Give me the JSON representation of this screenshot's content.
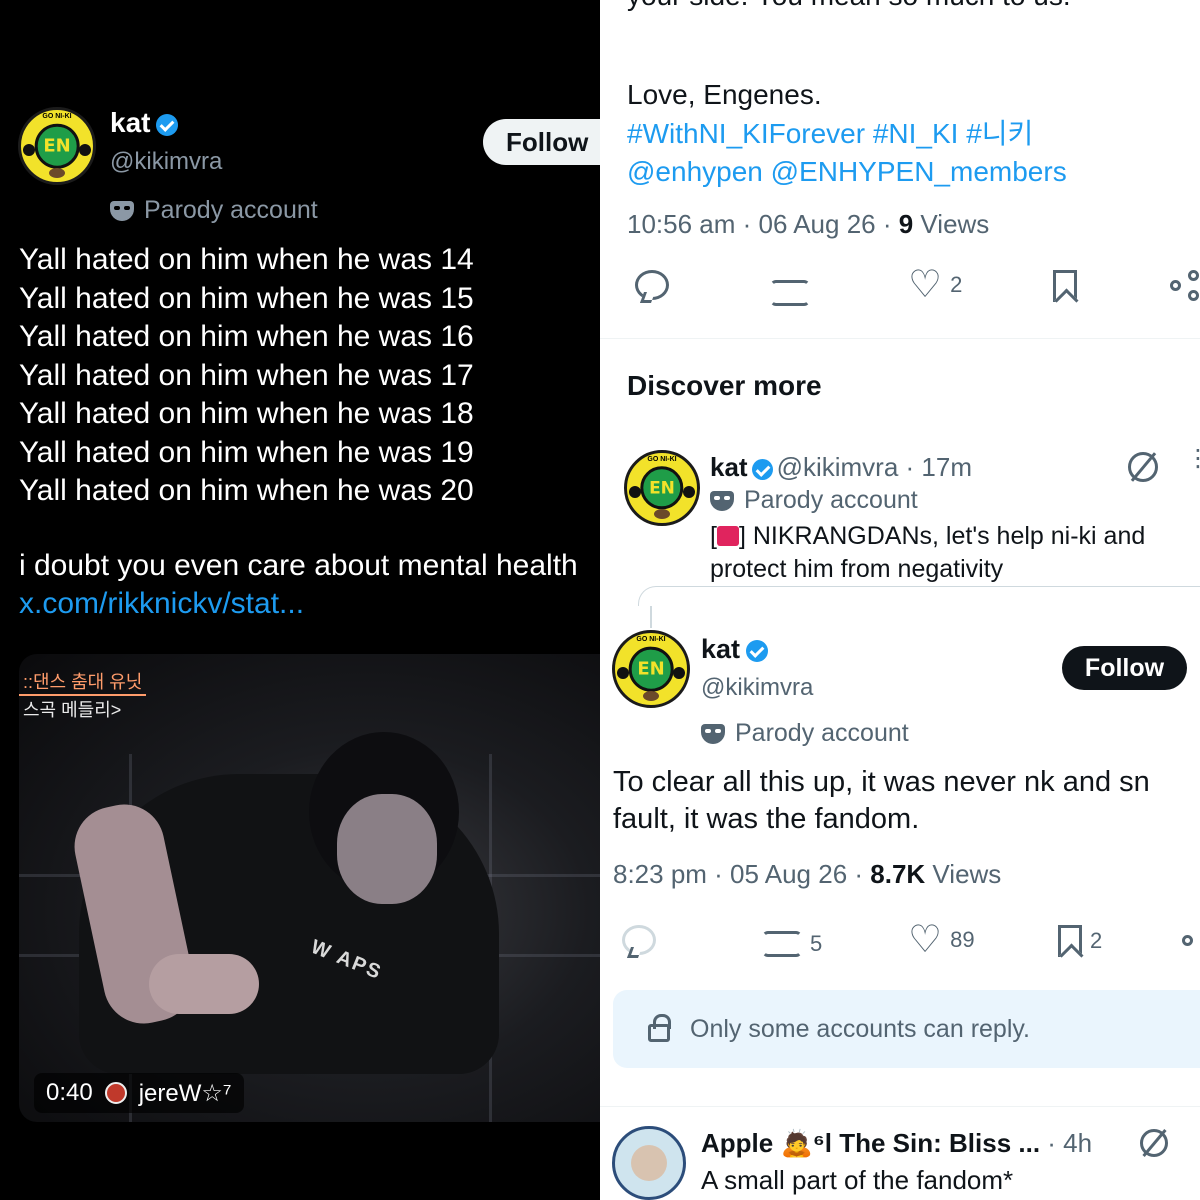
{
  "left_tweet": {
    "avatar_badge": "EN",
    "avatar_top_text": "GO NI-KI",
    "name": "kat",
    "handle": "@kikimvra",
    "follow_label": "Follow",
    "parody_label": "Parody account",
    "lines": [
      "Yall hated on him when he was 14",
      "Yall hated on him when he was 15",
      "Yall hated on him when he was 16",
      "Yall hated on him when he was 17",
      "Yall hated on him when he was 18",
      "Yall hated on him when he was 19",
      "Yall hated on him when he was 20"
    ],
    "tail_text": "i doubt you even care about mental health ",
    "link_text": "x.com/rikknickv/stat...",
    "video": {
      "korean_line1": "::댄스 춤대 유닛",
      "korean_line2": "스곡 메들리>",
      "shirt_text": "W APS",
      "duration": "0:40",
      "uploader": "jereW☆⁷"
    }
  },
  "right_panel": {
    "cut_text": "your side. You mean so much to us.",
    "love_line": "Love, Engenes.",
    "hashtags": "#WithNI_KIForever #NI_KI #니키",
    "mentions": "@enhypen @ENHYPEN_members",
    "meta1": {
      "time_date": "10:56 am · 06 Aug 26 · ",
      "views_count": "9",
      "views_label": " Views"
    },
    "actions1": {
      "likes": "2"
    },
    "discover_title": "Discover more",
    "discover_tweet": {
      "avatar_badge": "EN",
      "avatar_top_text": "GO NI-KI",
      "name": "kat",
      "handle_time": "@kikimvra · 17m",
      "parody_label": "Parody account",
      "text_after_alert": "] NIKRANGDANs, let's help ni-ki and protect him from negativity",
      "more": "⋮"
    },
    "main_tweet": {
      "avatar_badge": "EN",
      "avatar_top_text": "GO NI-KI",
      "name": "kat",
      "handle": "@kikimvra",
      "follow_label": "Follow",
      "parody_label": "Parody account",
      "text": "To clear all this up, it was never nk and sn\nfault, it was the fandom.",
      "meta": {
        "time_date": "8:23 pm · 05 Aug 26 · ",
        "views_count": "8.7K",
        "views_label": " Views"
      },
      "actions": {
        "retweets": "5",
        "likes": "89",
        "bookmarks": "2"
      }
    },
    "reply_restriction": "Only some accounts can reply.",
    "next_tweet": {
      "name": "Apple 🙇⁶l The Sin: Bliss ...",
      "time": " · 4h",
      "text": "A small part of the fandom*"
    }
  }
}
